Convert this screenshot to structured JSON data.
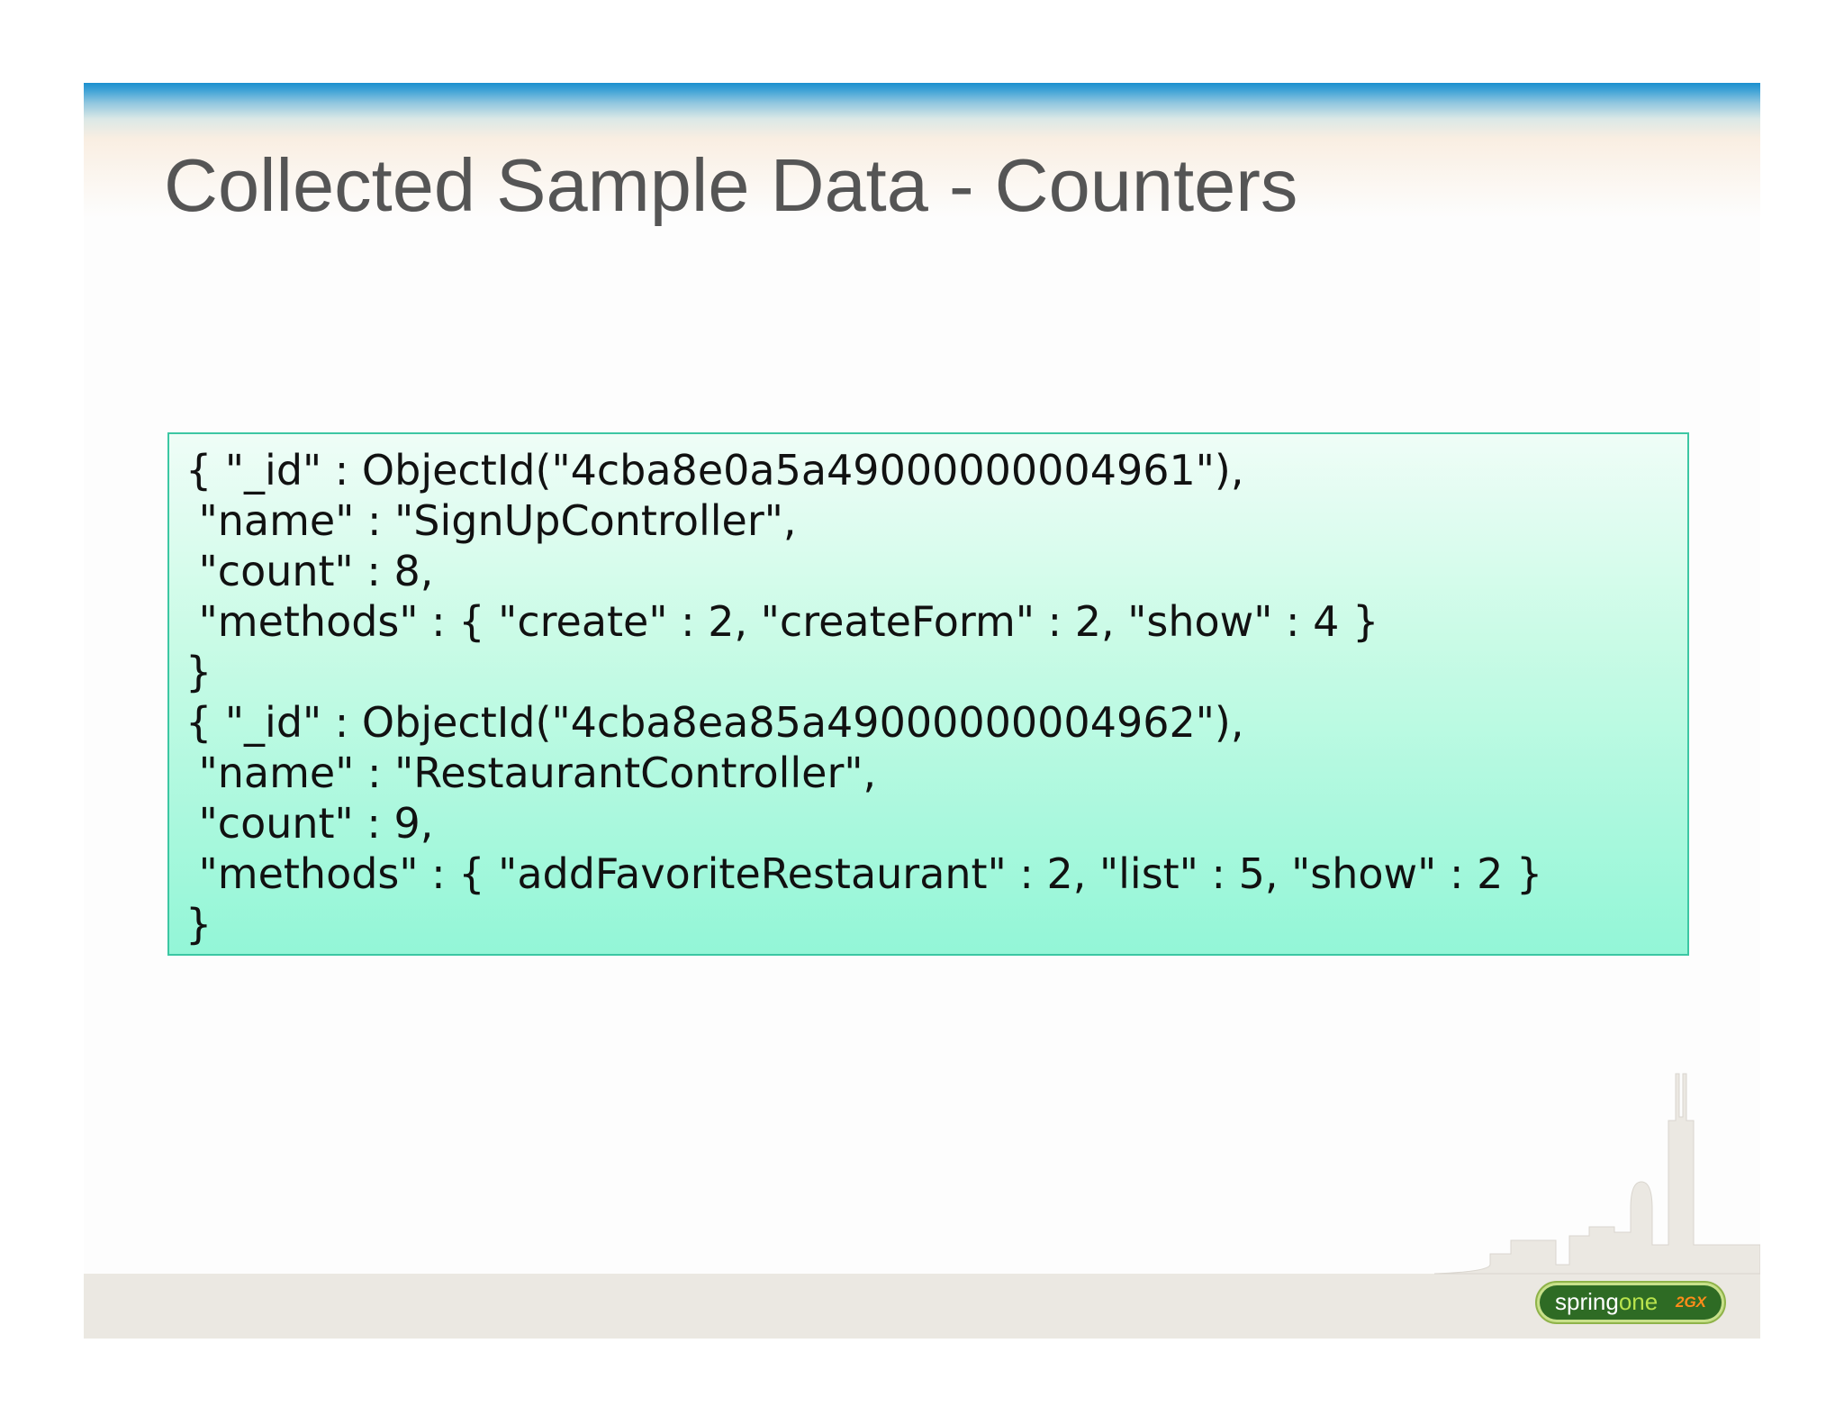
{
  "slide": {
    "title": "Collected Sample Data - Counters"
  },
  "code": {
    "lines": [
      "{ \"_id\" : ObjectId(\"4cba8e0a5a49000000004961\"),",
      " \"name\" : \"SignUpController\",",
      " \"count\" : 8,",
      " \"methods\" : { \"create\" : 2, \"createForm\" : 2, \"show\" : 4 }",
      "}",
      "{ \"_id\" : ObjectId(\"4cba8ea85a49000000004962\"),",
      " \"name\" : \"RestaurantController\",",
      " \"count\" : 9,",
      " \"methods\" : { \"addFavoriteRestaurant\" : 2, \"list\" : 5, \"show\" : 2 }",
      "}"
    ]
  },
  "logo": {
    "word_spring": "spring",
    "word_one": "one",
    "badge": "2GX"
  },
  "colors": {
    "title_gray": "#555555",
    "header_blue": "#1b90cf",
    "code_border": "#3cc7a3",
    "code_bg_bottom": "#93f6d7",
    "ground": "#ebe8e2",
    "logo_green": "#2e6b24",
    "logo_accent": "#b9e34d"
  }
}
